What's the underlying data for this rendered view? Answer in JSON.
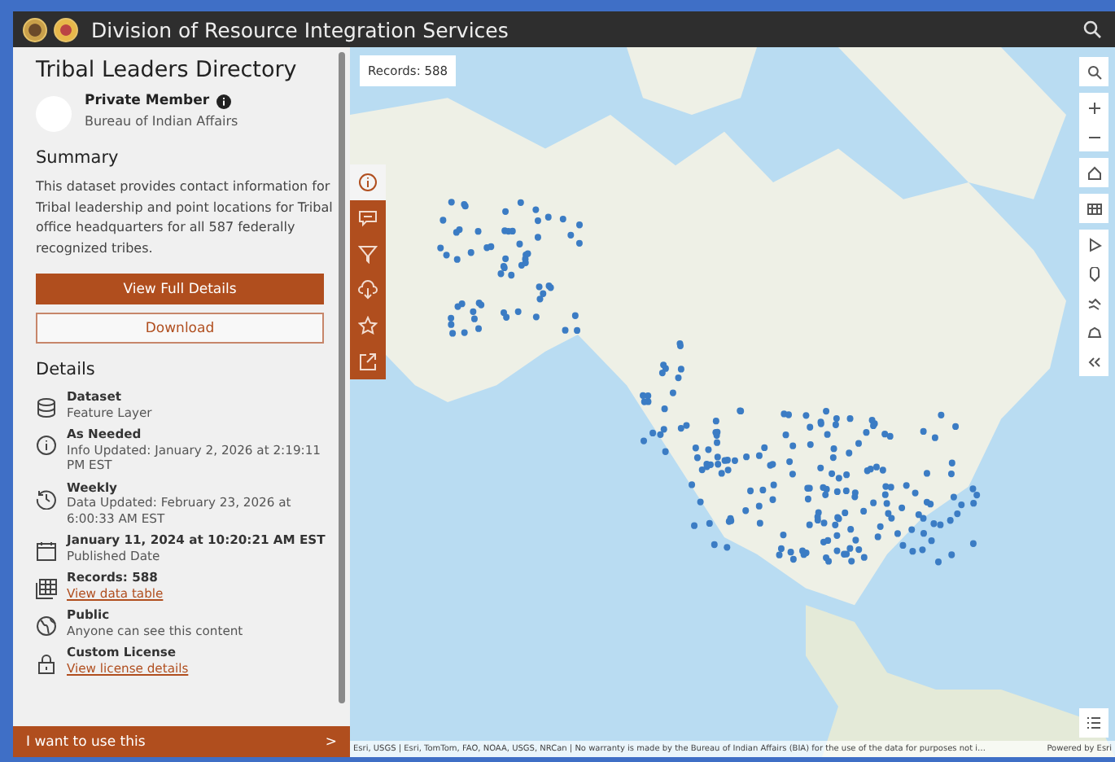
{
  "header": {
    "title": "Division of Resource Integration Services"
  },
  "panel": {
    "title": "Tribal Leaders Directory",
    "owner": {
      "name": "Private Member",
      "org": "Bureau of Indian Affairs"
    },
    "summary_heading": "Summary",
    "summary": "This dataset provides contact information for Tribal leadership and point locations for Tribal office headquarters for all 587 federally recognized tribes.",
    "buttons": [
      {
        "label": "View Full Details",
        "kind": "primary"
      },
      {
        "label": "Download",
        "kind": "outline"
      }
    ],
    "details_heading": "Details",
    "details": [
      {
        "kind": "database",
        "title": "Dataset",
        "text": "Feature Layer"
      },
      {
        "kind": "info",
        "title": "As Needed",
        "text": "Info Updated: January 2, 2026 at 2:19:11 PM EST"
      },
      {
        "kind": "history",
        "title": "Weekly",
        "text": "Data Updated: February 23, 2026 at 6:00:33 AM EST"
      },
      {
        "kind": "calendar",
        "title": "January 11, 2024 at 10:20:21 AM EST",
        "text": "Published Date"
      },
      {
        "kind": "table",
        "title": "Records: 588",
        "link": "View data table"
      },
      {
        "kind": "globe",
        "title": "Public",
        "text": "Anyone can see this content"
      },
      {
        "kind": "lock",
        "title": "Custom License",
        "link": "View license details"
      }
    ],
    "footer": {
      "label": "I want to use this",
      "arrow": ">"
    }
  },
  "side_tabs": [
    {
      "kind": "info",
      "selected": true
    },
    {
      "kind": "comment",
      "selected": false
    },
    {
      "kind": "filter",
      "selected": false
    },
    {
      "kind": "download",
      "selected": false
    },
    {
      "kind": "star",
      "selected": false
    },
    {
      "kind": "share",
      "selected": false
    }
  ],
  "map": {
    "records": "Records: 588",
    "attribution": "Esri, USGS | Esri, TomTom, FAO, NOAA, USGS, NRCan | No warranty is made by the Bureau of Indian Affairs (BIA) for the use of the data for purposes not i…",
    "powered": "Powered by Esri"
  }
}
